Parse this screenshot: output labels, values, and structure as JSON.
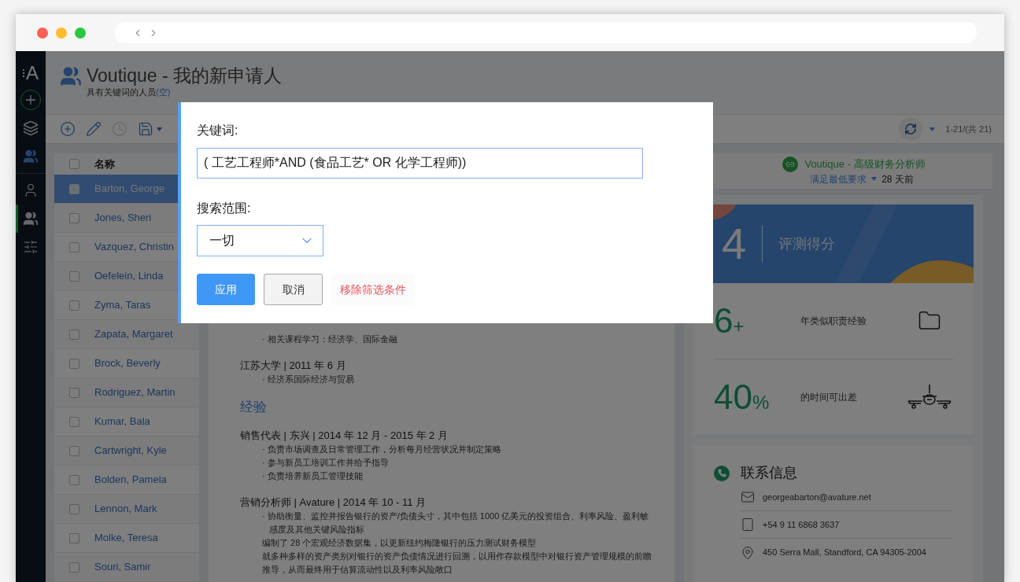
{
  "sidebar": {
    "logo": "A",
    "items": [
      {
        "kind": "folders",
        "selected": false,
        "highlighted": false
      },
      {
        "kind": "people",
        "selected": false,
        "highlighted": true
      },
      {
        "kind": "person",
        "selected": false,
        "highlighted": false
      },
      {
        "kind": "people",
        "selected": true,
        "highlighted": false
      },
      {
        "kind": "sliders",
        "selected": false,
        "highlighted": false
      }
    ]
  },
  "header": {
    "title": "Voutique - 我的新申请人",
    "subtitle": "具有关键词的人员",
    "subtitle_link": "(空)"
  },
  "toolbar": {
    "tools": [
      {
        "kind": "add",
        "disabled": false
      },
      {
        "kind": "edit",
        "disabled": false
      },
      {
        "kind": "history",
        "disabled": true
      },
      {
        "kind": "save",
        "disabled": false
      }
    ],
    "count": "1-21/(共 21)"
  },
  "list": {
    "column": "名称",
    "all_checked": false,
    "rows": [
      {
        "name": "Barton, George",
        "selected": true,
        "checked": false
      },
      {
        "name": "Jones, Sheri",
        "selected": false,
        "checked": false
      },
      {
        "name": "Vazquez, Christin",
        "selected": false,
        "checked": false
      },
      {
        "name": "Oefelein, Linda",
        "selected": false,
        "checked": false
      },
      {
        "name": "Zyma, Taras",
        "selected": false,
        "checked": false
      },
      {
        "name": "Zapata, Margaret",
        "selected": false,
        "checked": false
      },
      {
        "name": "Brock, Beverly",
        "selected": false,
        "checked": false
      },
      {
        "name": "Rodriguez, Martin",
        "selected": false,
        "checked": false
      },
      {
        "name": "Kumar, Bala",
        "selected": false,
        "checked": false
      },
      {
        "name": "Cartwright, Kyle",
        "selected": false,
        "checked": false
      },
      {
        "name": "Bolden, Pamela",
        "selected": false,
        "checked": false
      },
      {
        "name": "Lennon, Mark",
        "selected": false,
        "checked": false
      },
      {
        "name": "Molke, Teresa",
        "selected": false,
        "checked": false
      },
      {
        "name": "Souri, Samir",
        "selected": false,
        "checked": false
      }
    ]
  },
  "resume": {
    "bullet": "·",
    "blocks": [
      {
        "kind": "bullet",
        "text": "相关课程学习：经济学、国际金融"
      },
      {
        "kind": "heading",
        "text": "江苏大学 | 2011 年 6 月"
      },
      {
        "kind": "bullet",
        "text": "经济系国际经济与贸易"
      },
      {
        "kind": "section",
        "text": "经验"
      },
      {
        "kind": "heading",
        "text": "销售代表 | 东兴 | 2014 年 12 月 - 2015 年 2 月"
      },
      {
        "kind": "bullet",
        "text": "负责市场调查及日常管理工作，分析每月经营状况并制定策略"
      },
      {
        "kind": "bullet",
        "text": "参与新员工培训工作并给予指导"
      },
      {
        "kind": "bullet",
        "text": "负责培养新员工管理技能"
      },
      {
        "kind": "heading",
        "text": "营销分析师 | Avature | 2014 年 10 - 11 月"
      },
      {
        "kind": "bullet",
        "text": "协助衡量、监控并报告银行的资产/负债头寸，其中包括 1000 亿美元的投资组合、利率风险、盈利敏感度及其他关键风险指标"
      },
      {
        "kind": "line",
        "text": "编制了 28 个宏观经济数据集，以更新纽约梅隆银行的压力测试财务模型"
      },
      {
        "kind": "line",
        "text": "就多种多样的资产类别对银行的资产负债情况进行回溯，以用作存款模型中对银行资产管理规模的前瞻推导，从而最终用于估算流动性以及利率风险敞口"
      }
    ]
  },
  "job": {
    "title": "Voutique - 高级财务分析师",
    "status": "满足最低要求",
    "age": "28 天前"
  },
  "score": {
    "value": "4",
    "label": "评测得分"
  },
  "stats": [
    {
      "kind": "folder",
      "value": "6",
      "unit": "+",
      "label": "年类似职责经验"
    },
    {
      "kind": "plane",
      "value": "40",
      "unit": "%",
      "label": "的时间可出差"
    }
  ],
  "contact": {
    "title": "联系信息",
    "items": [
      {
        "kind": "email",
        "text": "georgeabarton@avature.net"
      },
      {
        "kind": "phone",
        "text": "+54 9 11 6868 3637"
      },
      {
        "kind": "address",
        "text": "450 Serra Mall, Standford, CA 94305-2004"
      }
    ]
  },
  "dialog": {
    "keyword_label": "关键词:",
    "keyword_value": "( 工艺工程师*AND (食品工艺* OR 化学工程师))",
    "scope_label": "搜索范围:",
    "scope_value": "一切",
    "buttons": [
      {
        "kind": "primary",
        "label": "应用"
      },
      {
        "kind": "secondary",
        "label": "取消"
      },
      {
        "kind": "danger",
        "label": "移除筛选条件"
      }
    ]
  }
}
